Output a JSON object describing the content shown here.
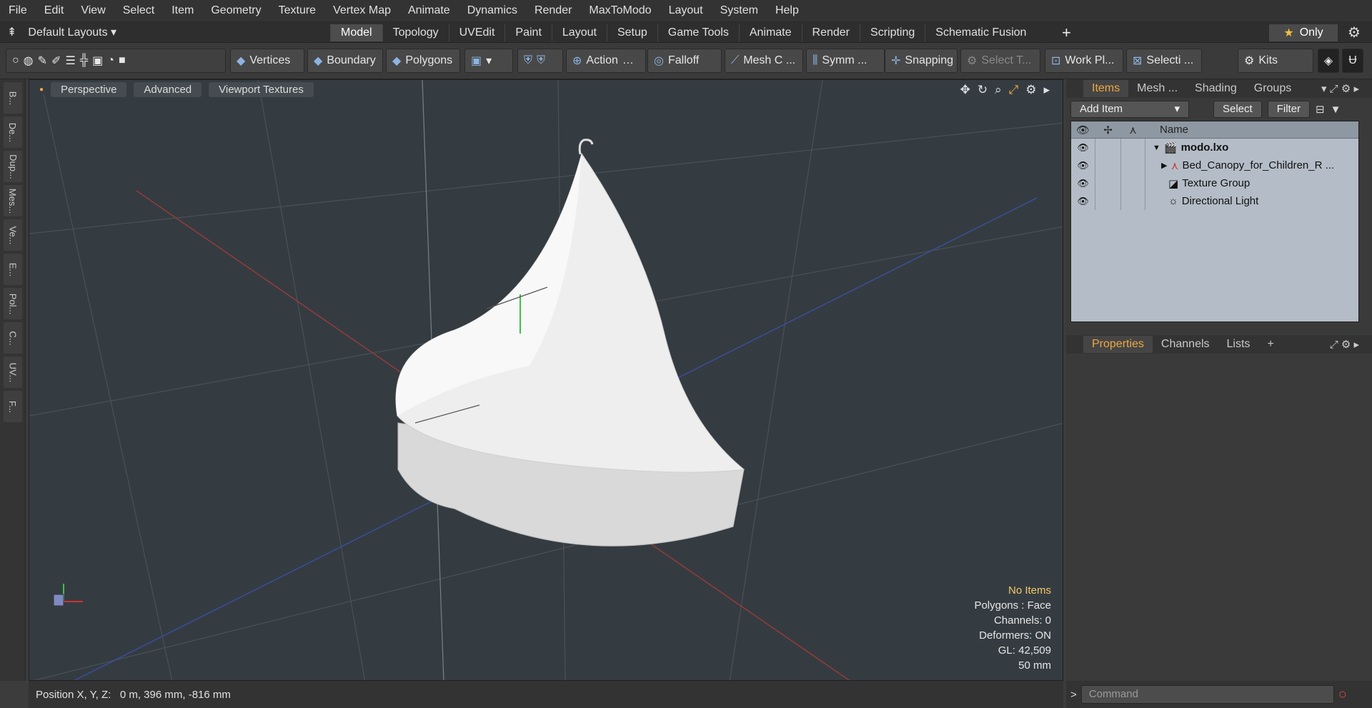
{
  "menu": [
    "File",
    "Edit",
    "View",
    "Select",
    "Item",
    "Geometry",
    "Texture",
    "Vertex Map",
    "Animate",
    "Dynamics",
    "Render",
    "MaxToModo",
    "Layout",
    "System",
    "Help"
  ],
  "layouts_label": "Default Layouts",
  "tabs": [
    {
      "label": "Model",
      "active": true
    },
    {
      "label": "Topology"
    },
    {
      "label": "UVEdit"
    },
    {
      "label": "Paint"
    },
    {
      "label": "Layout"
    },
    {
      "label": "Setup"
    },
    {
      "label": "Game Tools"
    },
    {
      "label": "Animate"
    },
    {
      "label": "Render"
    },
    {
      "label": "Scripting"
    },
    {
      "label": "Schematic Fusion"
    }
  ],
  "only_label": "Only",
  "toolbar": {
    "vertices": "Vertices",
    "boundary": "Boundary",
    "polygons": "Polygons",
    "action": "Action",
    "falloff": "Falloff",
    "mesh": "Mesh C ...",
    "symm": "Symm ...",
    "snapping": "Snapping",
    "select_t": "Select T...",
    "workpl": "Work Pl...",
    "selecti": "Selecti ...",
    "kits": "Kits"
  },
  "left_tabs": [
    "B...",
    "De...",
    "Dup...",
    "Mes...",
    "Ve...",
    "E...",
    "Pol...",
    "C...",
    "UV...",
    "F..."
  ],
  "viewport": {
    "perspective": "Perspective",
    "advanced": "Advanced",
    "textures": "Viewport Textures",
    "hud": [
      "No Items",
      "Polygons : Face",
      "Channels: 0",
      "Deformers: ON",
      "GL: 42,509",
      "50 mm"
    ]
  },
  "status": "Position X, Y, Z:   0 m, 396 mm, -816 mm",
  "items_panel": {
    "tabs": [
      "Items",
      "Mesh ...",
      "Shading",
      "Groups"
    ],
    "add_item": "Add Item",
    "select": "Select",
    "filter": "Filter",
    "name_header": "Name",
    "rows": [
      {
        "label": "modo.lxo",
        "bold": true,
        "indent": 0
      },
      {
        "label": "Bed_Canopy_for_Children_R ...",
        "indent": 1
      },
      {
        "label": "Texture Group",
        "indent": 1
      },
      {
        "label": "Directional Light",
        "indent": 1
      }
    ]
  },
  "props_panel": {
    "tabs": [
      "Properties",
      "Channels",
      "Lists"
    ]
  },
  "command_placeholder": "Command"
}
